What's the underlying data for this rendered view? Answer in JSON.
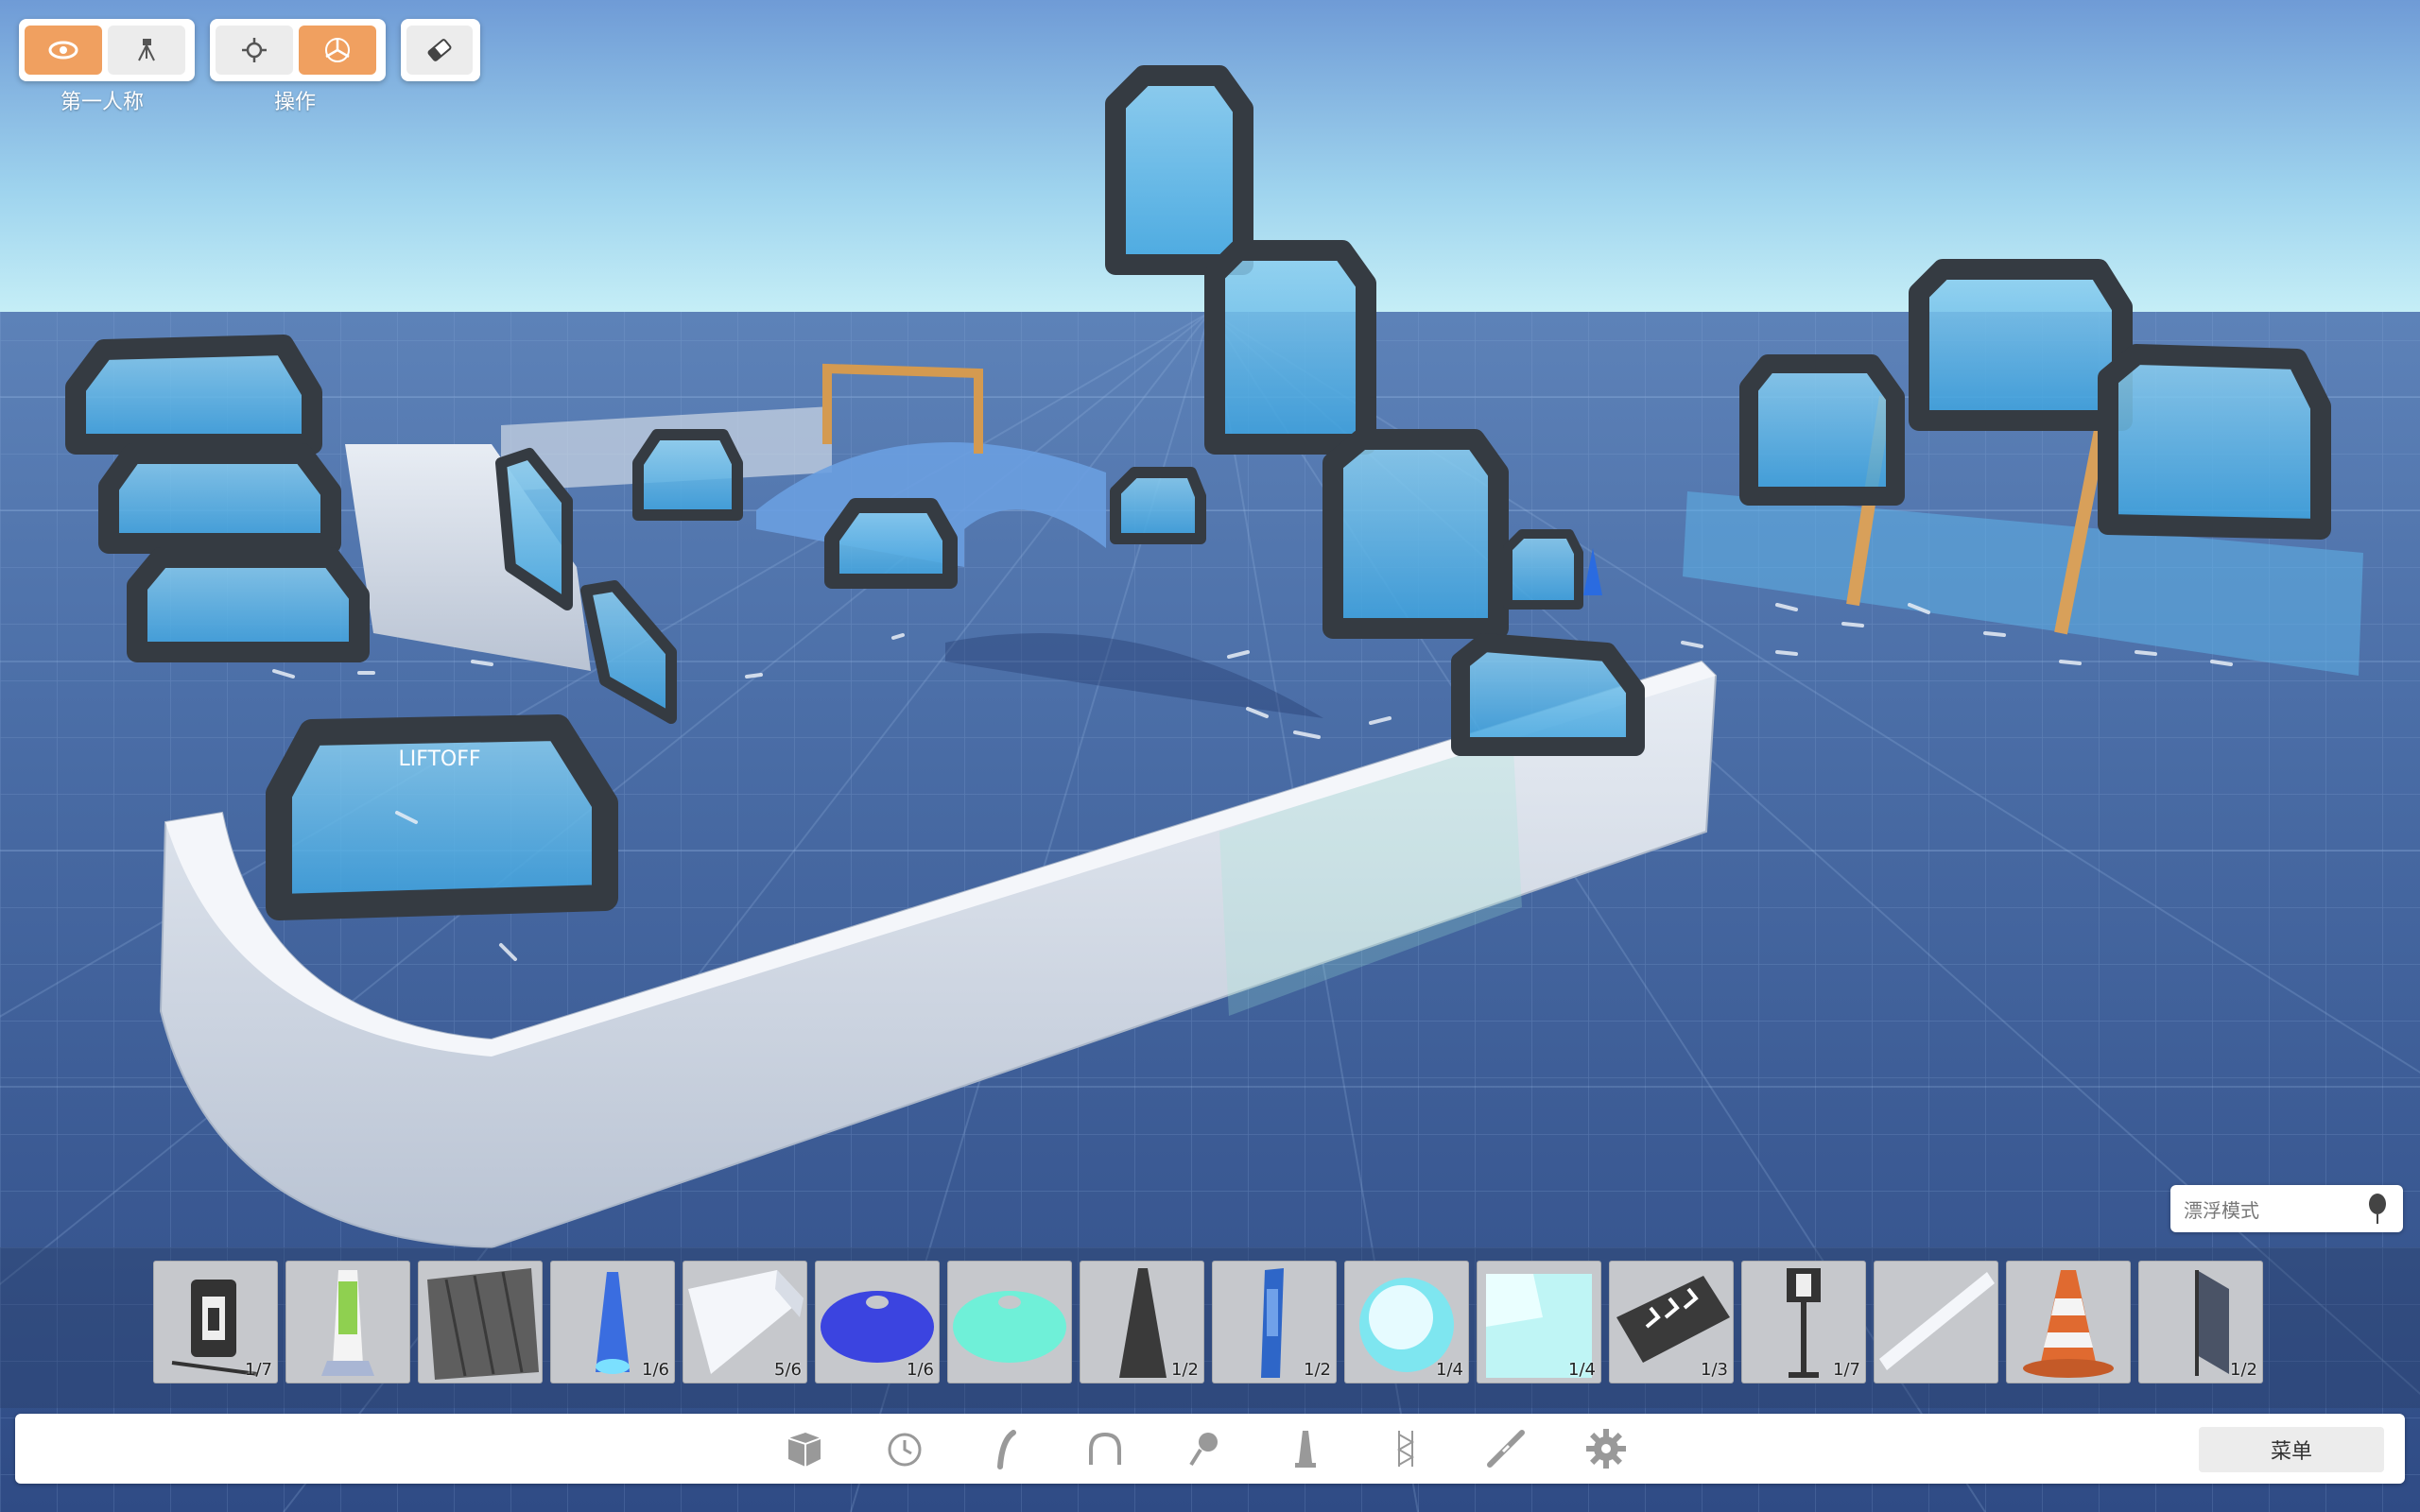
{
  "toolbar": {
    "view_group_label": "第一人称",
    "operate_group_label": "操作",
    "view_buttons": [
      {
        "icon": "eye-icon",
        "active": true
      },
      {
        "icon": "camera-tripod-icon",
        "active": false
      }
    ],
    "operate_buttons": [
      {
        "icon": "crosshair-icon",
        "active": false
      },
      {
        "icon": "move-gizmo-icon",
        "active": true
      }
    ],
    "eraser": {
      "icon": "eraser-icon"
    }
  },
  "scene": {
    "gate_brand_text": "LIFTOFF",
    "accent_colors": {
      "gate_frame": "#3a3f44",
      "gate_glass": "#6fb7e0",
      "wall": "#dfe5ee",
      "grid": "#3b5a92",
      "sky_top": "#6d9bd8",
      "sky_horizon": "#bfe9f5"
    }
  },
  "float_mode": {
    "placeholder": "漂浮模式",
    "icon": "balloon-icon"
  },
  "assets": [
    {
      "name": "gate-sign",
      "count": "1/7"
    },
    {
      "name": "green-pillar",
      "count": ""
    },
    {
      "name": "wood-panel",
      "count": ""
    },
    {
      "name": "blue-lamp",
      "count": "1/6"
    },
    {
      "name": "white-ramp",
      "count": "5/6"
    },
    {
      "name": "blue-cone-flat",
      "count": "1/6"
    },
    {
      "name": "cyan-cone-flat",
      "count": ""
    },
    {
      "name": "dark-tower",
      "count": "1/2"
    },
    {
      "name": "blue-banner",
      "count": "1/2"
    },
    {
      "name": "glow-sphere",
      "count": "1/4"
    },
    {
      "name": "glow-cube",
      "count": "1/4"
    },
    {
      "name": "arrow-panel",
      "count": "1/3"
    },
    {
      "name": "sign-post",
      "count": "1/7"
    },
    {
      "name": "white-stripe",
      "count": ""
    },
    {
      "name": "traffic-cone",
      "count": ""
    },
    {
      "name": "flag-panel",
      "count": "1/2"
    }
  ],
  "categories": [
    {
      "icon": "cube-icon"
    },
    {
      "icon": "clock-icon"
    },
    {
      "icon": "curve-icon"
    },
    {
      "icon": "arch-icon"
    },
    {
      "icon": "spotlight-icon"
    },
    {
      "icon": "pillar-icon"
    },
    {
      "icon": "truss-icon"
    },
    {
      "icon": "wand-icon"
    },
    {
      "icon": "gear-icon"
    }
  ],
  "menu_label": "菜单"
}
